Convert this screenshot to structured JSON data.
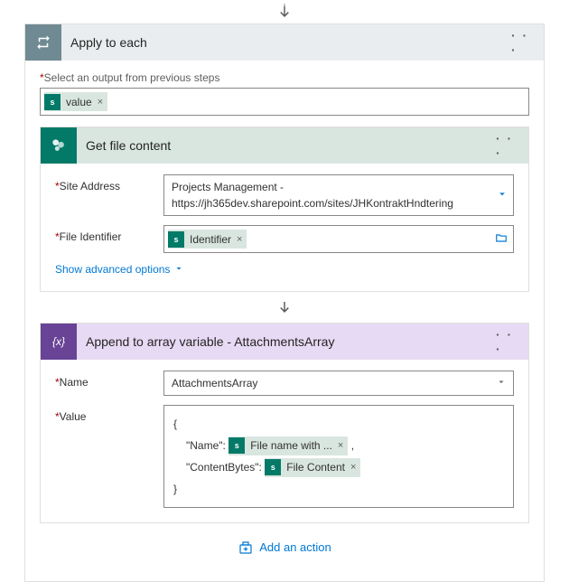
{
  "applyEach": {
    "title": "Apply to each",
    "selectLabel": "Select an output from previous steps",
    "valueToken": "value"
  },
  "getFile": {
    "title": "Get file content",
    "siteAddressLabel": "Site Address",
    "siteAddressValue": "Projects Management -\nhttps://jh365dev.sharepoint.com/sites/JHKontraktHndtering",
    "fileIdentifierLabel": "File Identifier",
    "identifierToken": "Identifier",
    "showAdvanced": "Show advanced options"
  },
  "append": {
    "title": "Append to array variable - AttachmentsArray",
    "nameLabel": "Name",
    "nameValue": "AttachmentsArray",
    "valueLabel": "Value",
    "valueOpen": "{",
    "valueNameKey": "\"Name\":",
    "fileNameWithToken": "File name with ...",
    "comma": ",",
    "valueContentBytesKey": "\"ContentBytes\":",
    "fileContentToken": "File Content",
    "valueClose": "}"
  },
  "addAction": "Add an action",
  "tokenX": "×",
  "menuDots": "· · ·",
  "spLetter": "s",
  "fxLabel": "{x}"
}
